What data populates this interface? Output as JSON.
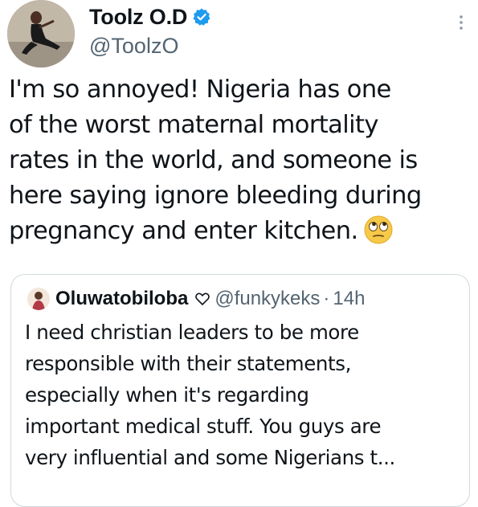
{
  "author": {
    "display_name": "Toolz O.D",
    "handle": "@ToolzO",
    "verified": true,
    "avatar": "profile-photo"
  },
  "tweet": {
    "text": "I'm so annoyed! Nigeria has one\nof the worst maternal mortality\nrates in the world, and someone is\nhere saying ignore bleeding during\npregnancy and enter kitchen.",
    "emoji": "face-with-rolling-eyes-icon"
  },
  "menu": {
    "icon": "more-options-icon"
  },
  "quote": {
    "display_name": "Oluwatobiloba",
    "name_icon": "heart-outline-icon",
    "handle": "@funkykeks",
    "separator": "·",
    "time": "14h",
    "text": "I need christian leaders to be more\nresponsible with their statements,\nespecially when it's regarding\nimportant medical stuff. You guys are\nvery influential and some Nigerians t..."
  },
  "colors": {
    "text_primary": "#0f1419",
    "text_secondary": "#536471",
    "verified_blue": "#1d9bf0",
    "border": "#cfd9de",
    "emoji_yellow": "#f7c948"
  }
}
